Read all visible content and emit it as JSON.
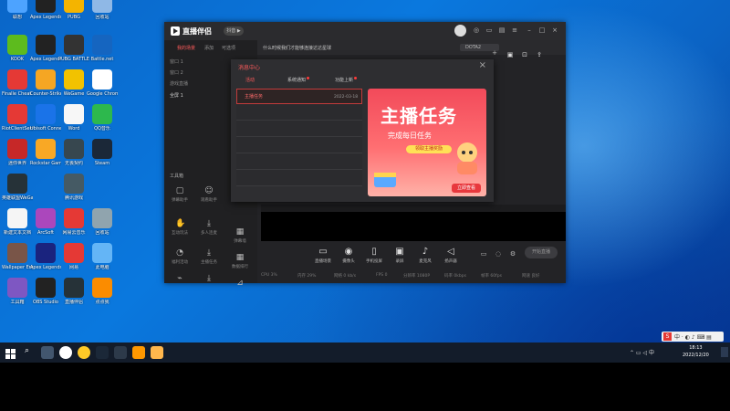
{
  "desktop_icons": [
    {
      "label": "联想",
      "col": 0,
      "row": 0,
      "color": "#4da3ff"
    },
    {
      "label": "Apex Legends",
      "col": 1,
      "row": 0,
      "color": "#222"
    },
    {
      "label": "PUBG",
      "col": 2,
      "row": 0,
      "color": "#f4b400"
    },
    {
      "label": "回收站",
      "col": 3,
      "row": 0,
      "color": "#8fb8e6"
    },
    {
      "label": "KOOK",
      "col": 0,
      "row": 1,
      "color": "#5dbb1e"
    },
    {
      "label": "Apex Legends",
      "col": 1,
      "row": 1,
      "color": "#222"
    },
    {
      "label": "PUBG BATTLEGROUNDS",
      "col": 2,
      "row": 1,
      "color": "#333"
    },
    {
      "label": "Battle.net",
      "col": 3,
      "row": 1,
      "color": "#1565c0"
    },
    {
      "label": "Finalle Cheat Code",
      "col": 0,
      "row": 2,
      "color": "#e53935"
    },
    {
      "label": "Counter-Strike Global Of...",
      "col": 1,
      "row": 2,
      "color": "#f5a623"
    },
    {
      "label": "WeGame",
      "col": 2,
      "row": 2,
      "color": "#f2c200"
    },
    {
      "label": "Google Chrome",
      "col": 3,
      "row": 2,
      "color": "#fff"
    },
    {
      "label": "RiotClientServices",
      "col": 0,
      "row": 3,
      "color": "#e53935"
    },
    {
      "label": "Ubisoft Connect",
      "col": 1,
      "row": 3,
      "color": "#1a73e8"
    },
    {
      "label": "Word",
      "col": 2,
      "row": 3,
      "color": "#f7f7f7"
    },
    {
      "label": "QQ音乐",
      "col": 3,
      "row": 3,
      "color": "#2db84d"
    },
    {
      "label": "迷你世界",
      "col": 0,
      "row": 4,
      "color": "#c62828"
    },
    {
      "label": "Rockstar Games",
      "col": 1,
      "row": 4,
      "color": "#f9a825"
    },
    {
      "label": "无畏契约",
      "col": 2,
      "row": 4,
      "color": "#37474f"
    },
    {
      "label": "Steam",
      "col": 3,
      "row": 4,
      "color": "#1b2838"
    },
    {
      "label": "英雄联盟WeGame版",
      "col": 0,
      "row": 5,
      "color": "#263238"
    },
    {
      "label": "腾讯游戏",
      "col": 2,
      "row": 5,
      "color": "#455a64"
    },
    {
      "label": "新建文本文档",
      "col": 0,
      "row": 6,
      "color": "#f5f5f5"
    },
    {
      "label": "ArcSoft",
      "col": 1,
      "row": 6,
      "color": "#ab47bc"
    },
    {
      "label": "网易云音乐",
      "col": 2,
      "row": 6,
      "color": "#e53935"
    },
    {
      "label": "回收站",
      "col": 3,
      "row": 6,
      "color": "#90a4ae"
    },
    {
      "label": "Wallpaper Engine",
      "col": 0,
      "row": 7,
      "color": "#795548"
    },
    {
      "label": "Apex Legends",
      "col": 1,
      "row": 7,
      "color": "#1a237e"
    },
    {
      "label": "网易",
      "col": 2,
      "row": 7,
      "color": "#e53935"
    },
    {
      "label": "此电脑",
      "col": 3,
      "row": 7,
      "color": "#64b5f6"
    },
    {
      "label": "工具箱",
      "col": 0,
      "row": 8,
      "color": "#7e57c2"
    },
    {
      "label": "OBS Studio",
      "col": 1,
      "row": 8,
      "color": "#222"
    },
    {
      "label": "直播伴侣",
      "col": 2,
      "row": 8,
      "color": "#263238"
    },
    {
      "label": "点点我",
      "col": 3,
      "row": 8,
      "color": "#fb8c00"
    }
  ],
  "app": {
    "name": "直播伴侣",
    "badge": "抖音 ▶",
    "left_tabs": [
      "我的场景",
      "添加",
      "可选项"
    ],
    "scenes": [
      "窗口 1",
      "窗口 2",
      "游戏直播",
      "全屏 1"
    ],
    "tools_header": "工具箱",
    "tools": [
      "弹幕助手",
      "观看助手",
      "互动玩法",
      "多人连麦",
      "福利活动",
      "主播任务",
      "直播工具",
      "弹幕墙",
      "数据排行",
      "更多"
    ],
    "topbar": {
      "title": "什么时候我们才能够连接达达星球",
      "game_tag": "DOTA2"
    },
    "bottom_buttons": [
      "直播场景",
      "摄像头",
      "手机投屏",
      "录屏",
      "麦克风",
      "扬声器"
    ],
    "live_button": "开始直播",
    "status": [
      "CPU 3%",
      "内存 29%",
      "网络 0 kb/s",
      "FPS 0",
      "分辨率 1080P",
      "码率 0kbps",
      "帧率 60fps",
      "网速 良好"
    ]
  },
  "message_center": {
    "title": "消息中心",
    "tabs": [
      "活动",
      "系统通知",
      "功能上新"
    ],
    "items": [
      {
        "title": "主播任务",
        "date": "2022-03-18"
      }
    ],
    "banner": {
      "headline": "主播任务",
      "subtitle": "完成每日任务",
      "pill": "领取主播奖励",
      "cta": "立即查看"
    }
  },
  "taskbar": {
    "time": "18:13",
    "date": "2022/12/20"
  }
}
